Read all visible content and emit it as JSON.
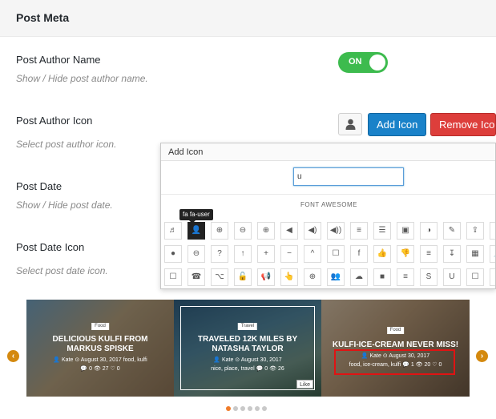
{
  "section": {
    "title": "Post Meta"
  },
  "settings": [
    {
      "label": "Post Author Name",
      "desc": "Show / Hide post author name."
    },
    {
      "label": "Post Author Icon",
      "desc": "Select post author icon."
    },
    {
      "label": "Post Date",
      "desc": "Show / Hide post date."
    },
    {
      "label": "Post Date Icon",
      "desc": "Select post date icon."
    }
  ],
  "toggle": {
    "label": "ON",
    "on": true,
    "color": "#3dbb4e"
  },
  "author_icon": {
    "preview": "user-icon",
    "add_label": "Add Icon",
    "remove_label": "Remove Icon"
  },
  "modal": {
    "title": "Add Icon",
    "search_value": "u",
    "group_label": "FONT AWESOME",
    "tooltip": "fa fa-user",
    "selected_icon": "fa fa-user",
    "rows": [
      [
        "♬",
        "👤",
        "⊕",
        "⊖",
        "⊕",
        "◀",
        "◀)",
        "◀))",
        "≡",
        "☰",
        "▣",
        "◑",
        "✎",
        "⇪",
        "↗"
      ],
      [
        "●",
        "⊖",
        "?",
        "↑",
        "+",
        "−",
        "^",
        "☐",
        "f",
        "👍",
        "👎",
        "≡",
        "↧",
        "▦",
        "📌"
      ],
      [
        "☐",
        "☎",
        "⌥",
        "🔓",
        "📢",
        "👆",
        "⊕",
        "👥",
        "☁",
        "■",
        "≡",
        "S",
        "U",
        "☐",
        "☐"
      ]
    ]
  },
  "slider": {
    "slides": [
      {
        "category": "Food",
        "title": "DELICIOUS KULFI FROM MARKUS SPISKE",
        "meta1": "👤 Kate  ⊙ August 30, 2017",
        "meta2": "💬 0  👁 27  ♡ 0",
        "tags": "food, kulfi"
      },
      {
        "category": "Travel",
        "title": "TRAVELED 12K MILES BY NATASHA TAYLOR",
        "meta1": "👤 Kate  ⊙ August 30, 2017",
        "meta2": "nice, place, travel  💬 0  👁 26",
        "like": "Like"
      },
      {
        "category": "Food",
        "title": "KULFI-ICE-CREAM NEVER MISS!",
        "meta1": "👤 Kate  ⊙ August 30, 2017",
        "meta2": "food, ice-cream, kulfi  💬 1  👁 20  ♡ 0"
      }
    ],
    "active_dot": 0,
    "dot_count": 6,
    "accent": "#d4890f"
  }
}
